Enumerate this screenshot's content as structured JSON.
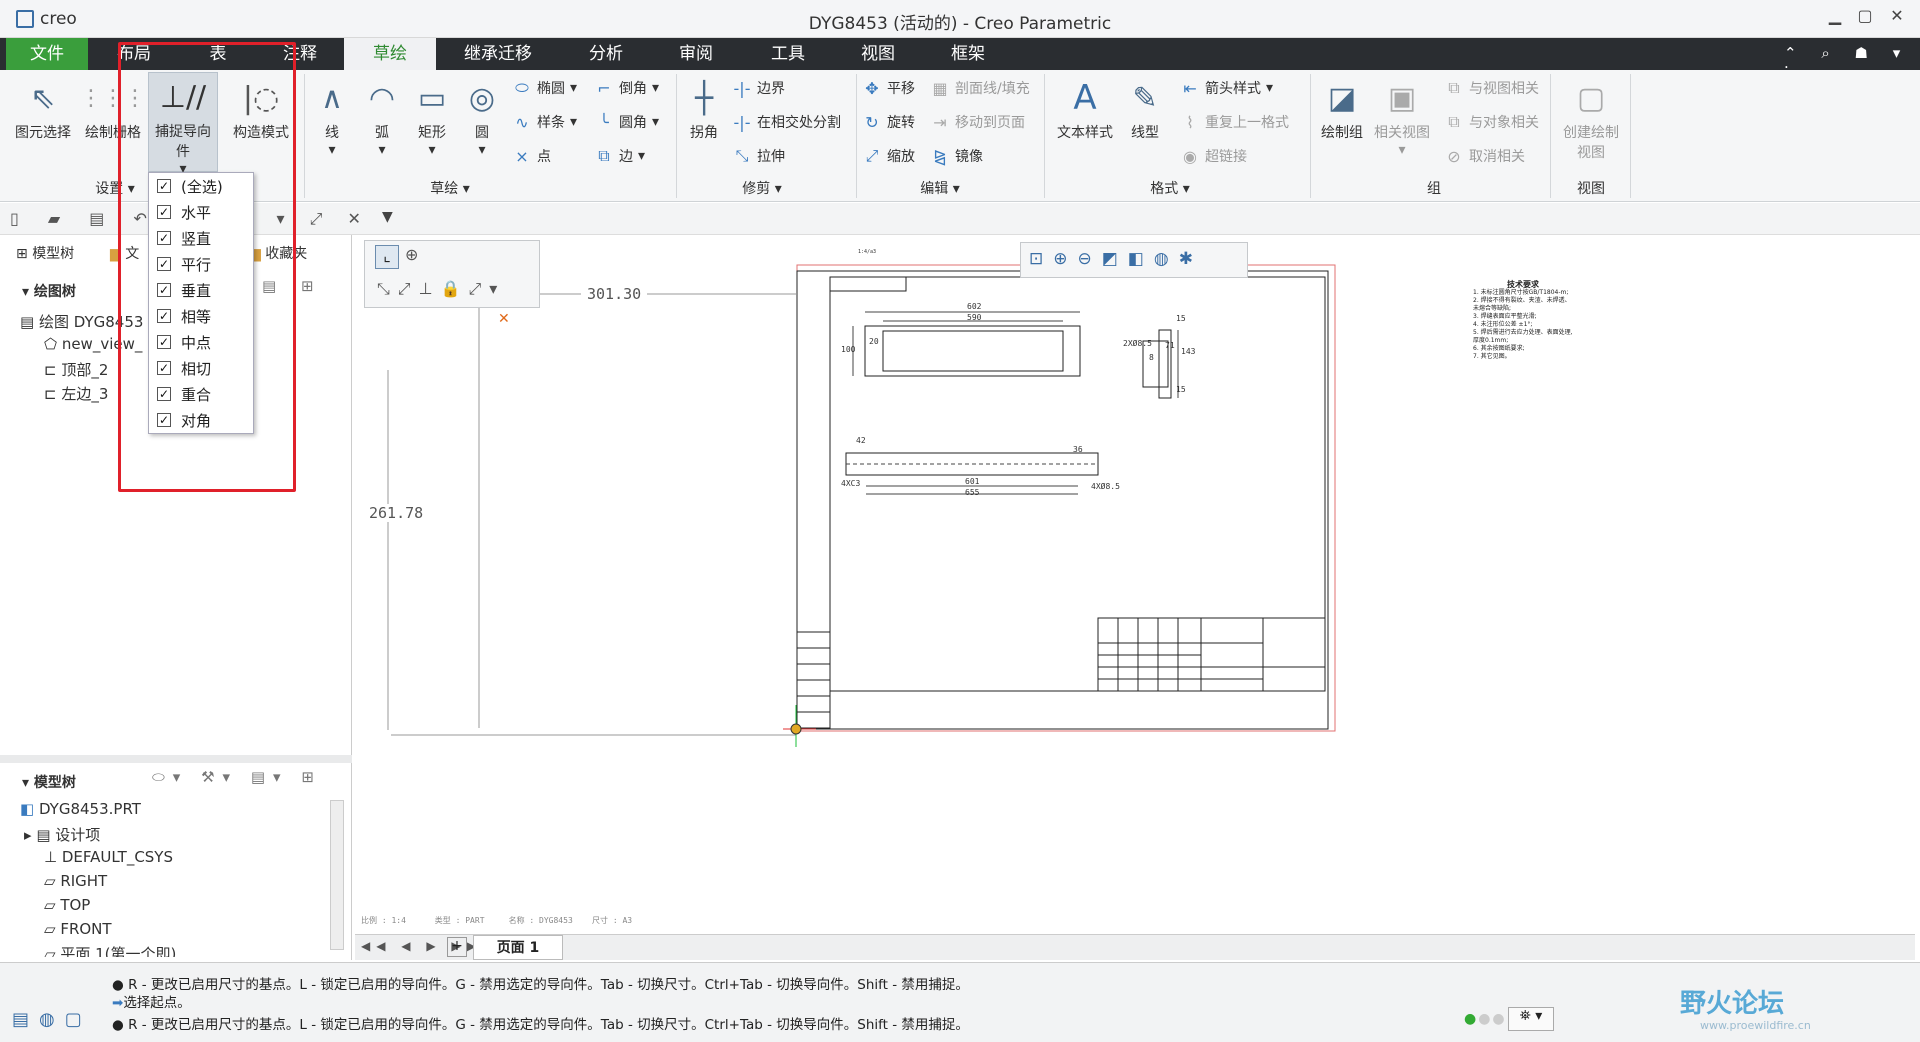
{
  "window": {
    "app": "creo",
    "title": "DYG8453 (活动的) - Creo Parametric"
  },
  "menu": {
    "tabs": [
      "文件",
      "布局",
      "表",
      "注释",
      "草绘",
      "继承迁移",
      "分析",
      "审阅",
      "工具",
      "视图",
      "框架"
    ],
    "active": "草绘"
  },
  "ribbon": {
    "settings": {
      "select": "图元选择",
      "grid": "绘制栅格",
      "snap": "捕捉导向件",
      "construct": "构造模式",
      "group": "设置"
    },
    "sketch": {
      "line": "线",
      "arc": "弧",
      "rect": "矩形",
      "circle": "圆",
      "ellipse": "椭圆",
      "spline": "样条",
      "point": "点",
      "chamfer": "倒角",
      "fillet": "圆角",
      "edge": "边",
      "group": "草绘"
    },
    "trim": {
      "corner": "拐角",
      "boundary": "边界",
      "split": "在相交处分割",
      "stretch": "拉伸",
      "group": "修剪"
    },
    "edit": {
      "translate": "平移",
      "rotate": "旋转",
      "scale": "缩放",
      "section_fill": "剖面线/填充",
      "move_page": "移动到页面",
      "mirror": "镜像",
      "group": "编辑"
    },
    "format": {
      "text_style": "文本样式",
      "line_style": "线型",
      "arrow_style": "箭头样式",
      "repeat_format": "重复上一格式",
      "hyperlink": "超链接",
      "group": "格式"
    },
    "grp": {
      "draw_group": "绘制组",
      "relative_view": "相关视图",
      "view_relate": "与视图相关",
      "obj_relate": "与对象相关",
      "unrelate": "取消相关",
      "group": "组"
    },
    "view": {
      "create_view": "创建绘制视图",
      "group": "视图"
    }
  },
  "snap_menu": {
    "items": [
      "(全选)",
      "水平",
      "竖直",
      "平行",
      "垂直",
      "相等",
      "中点",
      "相切",
      "重合",
      "对角"
    ],
    "checked": true
  },
  "left_panel": {
    "tabs": [
      "模型树",
      "文",
      "收藏夹"
    ],
    "drawing_tree": {
      "header": "绘图树",
      "items": [
        "绘图 DYG8453",
        "new_view_",
        "顶部_2",
        "左边_3"
      ]
    },
    "model_tree": {
      "header": "模型树",
      "items": [
        "DYG8453.PRT",
        "设计项",
        "DEFAULT_CSYS",
        "RIGHT",
        "TOP",
        "FRONT",
        "平面 1(第一个即)"
      ]
    }
  },
  "canvas": {
    "dim_h": "301.30",
    "dim_v": "261.78",
    "footer": "比例 : 1:4      类型 : PART     名称 : DYG8453    尺寸 : A3"
  },
  "drawing": {
    "notes_title": "技术要求",
    "notes": [
      "1. 未标注圆角尺寸按GB/T1804-m;",
      "2. 焊接不得有裂纹、夹渣、未焊透、未熔合等缺陷;",
      "3. 焊缝表面应平整光滑;",
      "4. 未注形位公差 ±1°;",
      "5. 焊后需进行去应力处理、表面处理, 厚度0.1mm;",
      "6. 其余按图纸要求;",
      "7. 其它见图。"
    ],
    "dims": [
      "602",
      "590",
      "100",
      "20",
      "15",
      "2XØ8.5",
      "8",
      "71",
      "143",
      "15",
      "42",
      "36",
      "601",
      "655",
      "4XC3",
      "4XØ8.5"
    ],
    "label": "1:4/a3"
  },
  "page_tab": "页面 1",
  "status": {
    "line1": "R - 更改已启用尺寸的基点。L - 锁定已启用的导向件。G - 禁用选定的导向件。Tab - 切换尺寸。Ctrl+Tab - 切换导向件。Shift - 禁用捕捉。",
    "line2": "选择起点。",
    "line3": "R - 更改已启用尺寸的基点。L - 锁定已启用的导向件。G - 禁用选定的导向件。Tab - 切换尺寸。Ctrl+Tab - 切换导向件。Shift - 禁用捕捉。"
  },
  "watermark": {
    "text": "野火论坛",
    "url": "www.proewildfire.cn"
  },
  "colors": {
    "accent_green": "#3a9e3c",
    "menubar": "#2a2d31",
    "highlight": "#e0202a"
  }
}
